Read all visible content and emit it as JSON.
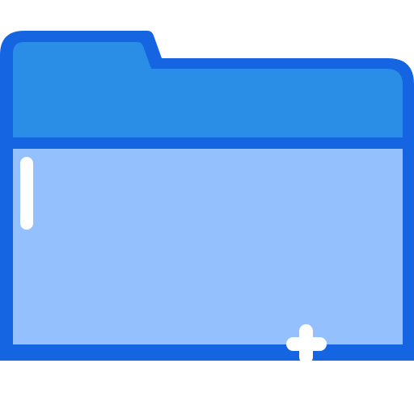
{
  "icon": {
    "name": "folder-add-icon",
    "colors": {
      "outline": "#1565e3",
      "tab_fill": "#2b8ee6",
      "body_fill": "#94c1fd",
      "highlight": "#ffffff",
      "background": "#ffffff"
    },
    "badge": "plus-icon",
    "highlight_stripe": "shine-stripe"
  }
}
